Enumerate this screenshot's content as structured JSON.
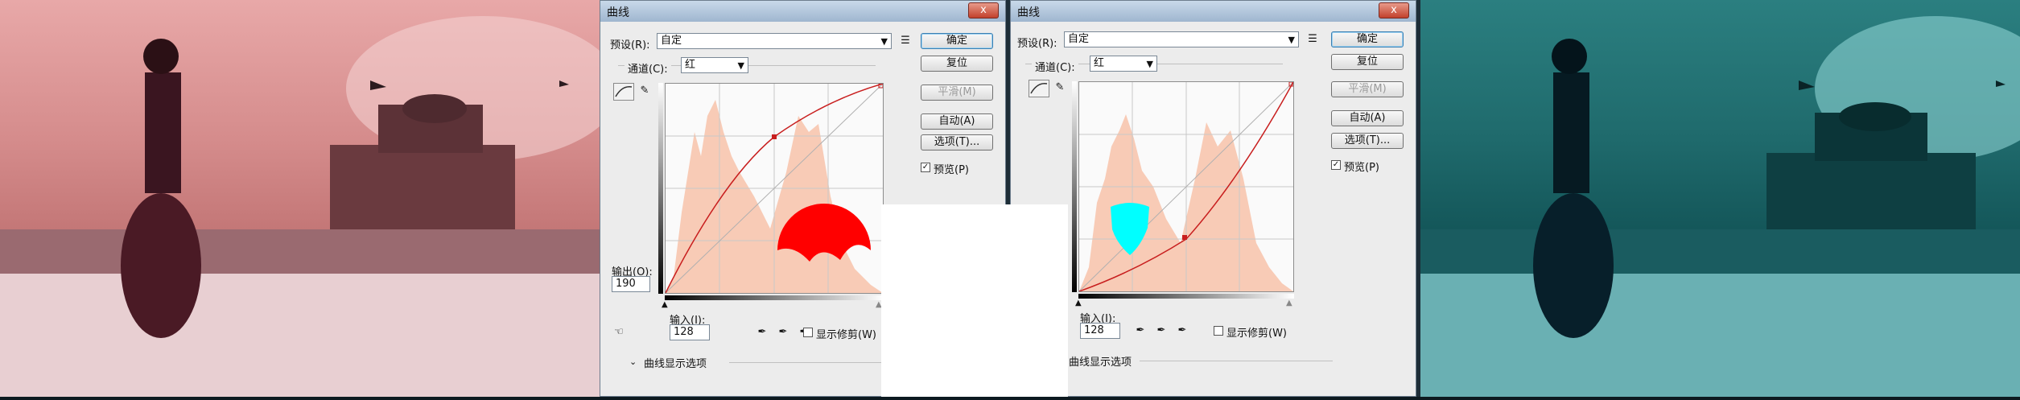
{
  "dialogs": [
    {
      "title": "曲线",
      "close_label": "x",
      "preset_label": "预设(R):",
      "preset_value": "自定",
      "channel_label": "通道(C):",
      "channel_value": "红",
      "buttons": {
        "ok": "确定",
        "reset": "复位",
        "smooth": "平滑(M)",
        "auto": "自动(A)",
        "options": "选项(T)..."
      },
      "preview_label": "预览(P)",
      "output_label": "输出(O):",
      "output_value": "190",
      "input_label": "输入(I):",
      "input_value": "128",
      "show_clipping": "显示修剪(W)",
      "curve_options": "曲线显示选项"
    },
    {
      "title": "曲线",
      "close_label": "x",
      "preset_label": "预设(R):",
      "preset_value": "自定",
      "channel_label": "通道(C):",
      "channel_value": "红",
      "buttons": {
        "ok": "确定",
        "reset": "复位",
        "smooth": "平滑(M)",
        "auto": "自动(A)",
        "options": "选项(T)..."
      },
      "preview_label": "预览(P)",
      "input_label": "输入(I):",
      "input_value": "128",
      "show_clipping": "显示修剪(W)",
      "curve_options": "曲线显示选项"
    }
  ],
  "colors": {
    "red": "#ff0000",
    "green": "#00ff00",
    "blue": "#0000ff",
    "cyan": "#00ffff",
    "magenta": "#ff00ff",
    "yellow": "#ffff00"
  }
}
